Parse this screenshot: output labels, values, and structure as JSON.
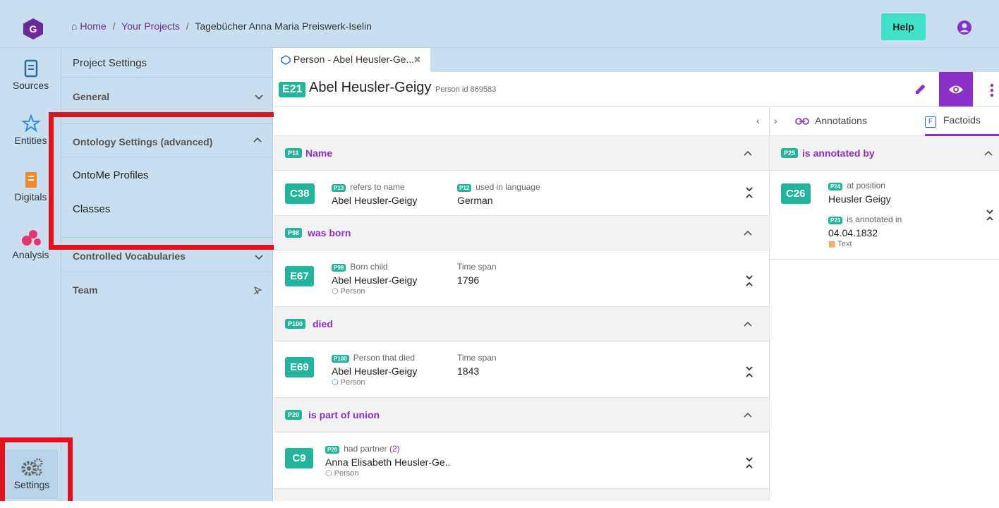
{
  "breadcrumb": {
    "home": "Home",
    "sep1": "/",
    "projects": "Your Projects",
    "sep2": "/",
    "current": "Tagebücher Anna Maria Preiswerk-Iselin"
  },
  "header": {
    "help_label": "Help"
  },
  "rail": {
    "sources": "Sources",
    "entities": "Entities",
    "digitals": "Digitals",
    "analysis": "Analysis",
    "settings": "Settings"
  },
  "panel": {
    "title": "Project Settings",
    "general": "General",
    "ontology": "Ontology Settings (advanced)",
    "ontome_profiles": "OntoMe Profiles",
    "classes": "Classes",
    "vocabularies": "Controlled Vocabularies",
    "team": "Team"
  },
  "tab": {
    "label": "Person - Abel Heusler-Ge...",
    "close": "✖"
  },
  "entity": {
    "code": "E21",
    "name": "Abel Heusler-Geigy",
    "meta": "Person id 869583"
  },
  "toolbar": {
    "collapse_left": "‹",
    "expand_right": "›"
  },
  "properties": [
    {
      "code": "P11",
      "label": "Name",
      "statement": {
        "code": "C38",
        "f1_code": "P13",
        "f1_label": "refers to name",
        "f1_value": "Abel Heusler-Geigy",
        "f2_code": "P12",
        "f2_label": "used in language",
        "f2_value": "German"
      }
    },
    {
      "code": "P98",
      "label": "was born",
      "statement": {
        "code": "E67",
        "f1_code": "P98",
        "f1_label": "Born child",
        "f1_value": "Abel Heusler-Geigy",
        "f1_sub": "Person",
        "f2_label": "Time span",
        "f2_value": "1796"
      }
    },
    {
      "code": "P100",
      "label": "died",
      "statement": {
        "code": "E69",
        "f1_code": "P100",
        "f1_label": "Person that died",
        "f1_value": "Abel Heusler-Geigy",
        "f1_sub": "Person",
        "f2_label": "Time span",
        "f2_value": "1843"
      }
    },
    {
      "code": "P20",
      "label": "is part of union",
      "statement": {
        "code": "C9",
        "f1_code": "P20",
        "f1_label": "had partner",
        "f1_count": "(2)",
        "f1_value": "Anna Elisabeth Heusler-Ge..",
        "f1_sub": "Person"
      }
    }
  ],
  "right": {
    "annotations_tab": "Annotations",
    "factoids_tab": "Factoids",
    "factoids_icon": "F",
    "prop_code": "P25",
    "prop_label": "is annotated by",
    "stmt_code": "C26",
    "f1_code": "P24",
    "f1_label": "at position",
    "f1_value": "Heusler Geigy",
    "f2_code": "P23",
    "f2_label": "is annotated in",
    "f2_value": "04.04.1832",
    "f2_sub": "Text"
  },
  "colors": {
    "accent": "#8b2fc9",
    "badge": "#23b49c",
    "help": "#3fe0c6",
    "highlight": "#e2111a",
    "panel_bg": "#c9dfef"
  },
  "icons": [
    "logo-icon",
    "home-icon",
    "user-icon",
    "sources-icon",
    "entities-icon",
    "digitals-icon",
    "analysis-icon",
    "settings-gears-icon",
    "person-tab-icon",
    "edit-pencil-icon",
    "eye-icon",
    "more-vert-icon",
    "link-icon",
    "chevron-up-icon",
    "chevron-down-icon",
    "expand-collapse-icon",
    "pin-icon",
    "document-icon"
  ]
}
